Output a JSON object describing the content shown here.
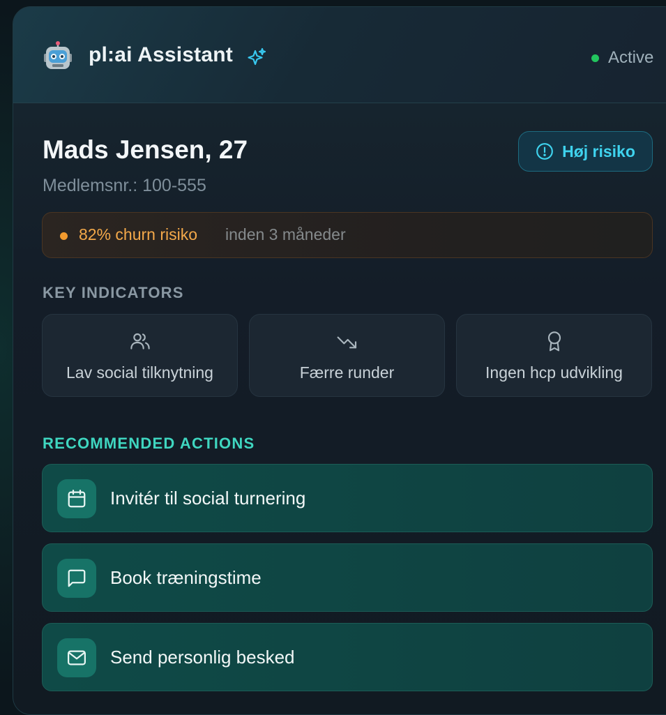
{
  "header": {
    "title": "pl:ai Assistant",
    "icon": "robot-icon",
    "status": {
      "label": "Active",
      "color": "#22c55e"
    }
  },
  "member": {
    "name": "Mads Jensen, 27",
    "member_id": "Medlemsnr.: 100-555",
    "risk_badge": {
      "label": "Høj risiko",
      "icon": "alert-circle-icon"
    }
  },
  "churn": {
    "headline": "82% churn risiko",
    "detail": "inden 3 måneder",
    "color": "#f29a2e"
  },
  "key_indicators": {
    "label": "KEY INDICATORS",
    "items": [
      {
        "label": "Lav social tilknytning",
        "icon": "users-icon"
      },
      {
        "label": "Færre runder",
        "icon": "trending-down-icon"
      },
      {
        "label": "Ingen hcp udvikling",
        "icon": "award-icon"
      }
    ]
  },
  "recommended_actions": {
    "label": "RECOMMENDED ACTIONS",
    "items": [
      {
        "label": "Invitér til social turnering",
        "icon": "calendar-icon"
      },
      {
        "label": "Book træningstime",
        "icon": "message-square-icon"
      },
      {
        "label": "Send personlig besked",
        "icon": "mail-icon"
      }
    ]
  }
}
